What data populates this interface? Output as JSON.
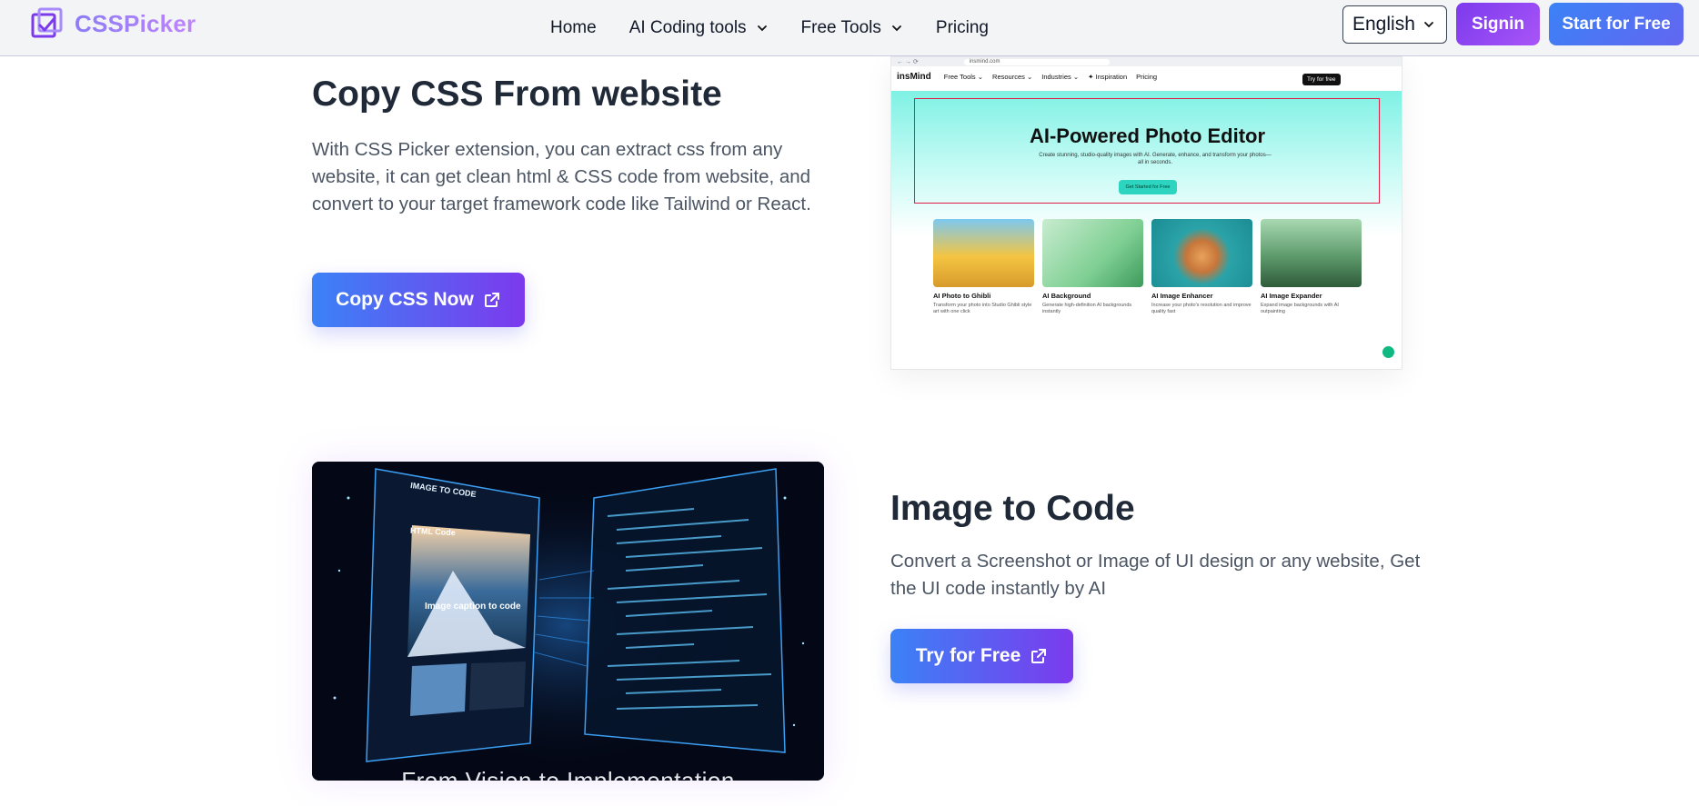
{
  "header": {
    "brand": "CSSPicker",
    "nav": [
      {
        "label": "Home",
        "dropdown": false
      },
      {
        "label": "AI Coding tools",
        "dropdown": true
      },
      {
        "label": "Free Tools",
        "dropdown": true
      },
      {
        "label": "Pricing",
        "dropdown": false
      }
    ],
    "language": "English",
    "signin": "Signin",
    "start": "Start for Free"
  },
  "section_copy": {
    "title": "Copy CSS From website",
    "description": "With CSS Picker extension, you can extract css from any website, it can get clean html & CSS code from website, and convert to your target framework code like Tailwind or React.",
    "button": "Copy CSS Now",
    "preview": {
      "url": "insmind.com",
      "brand": "insMind",
      "nav": [
        "Free Tools ⌄",
        "Resources ⌄",
        "Industries ⌄",
        "✦ Inspiration",
        "Pricing"
      ],
      "try_button": "Try for free",
      "hero_title": "AI-Powered Photo Editor",
      "hero_subtitle": "Create stunning, studio-quality images with AI. Generate, enhance, and transform your photos—all in seconds.",
      "hero_button": "Get Started for Free",
      "cards": [
        {
          "name": "AI Photo to Ghibli",
          "desc": "Transform your photo into Studio Ghibli style art with one click"
        },
        {
          "name": "AI Background",
          "desc": "Generate high-definition AI backgrounds instantly"
        },
        {
          "name": "AI Image Enhancer",
          "desc": "Increase your photo's resolution and improve quality fast"
        },
        {
          "name": "AI Image Expander",
          "desc": "Expand image backgrounds with AI outpainting"
        }
      ]
    }
  },
  "section_image": {
    "title": "Image to Code",
    "description": "Convert a Screenshot or Image of UI design or any website, Get the UI code instantly by AI",
    "button": "Try for Free",
    "art_caption": "From Vision to Implementation",
    "art_panel_title": "IMAGE TO CODE",
    "art_panel_heading": "HTML Code",
    "art_panel_overlay": "Image caption to code"
  },
  "colors": {
    "brand_purple": "#7c3aed",
    "brand_blue": "#3b82f6",
    "heading": "#1f2937",
    "body_text": "#4b5563"
  },
  "icons": [
    "logo-check-icon",
    "chevron-down-icon",
    "external-link-icon"
  ]
}
